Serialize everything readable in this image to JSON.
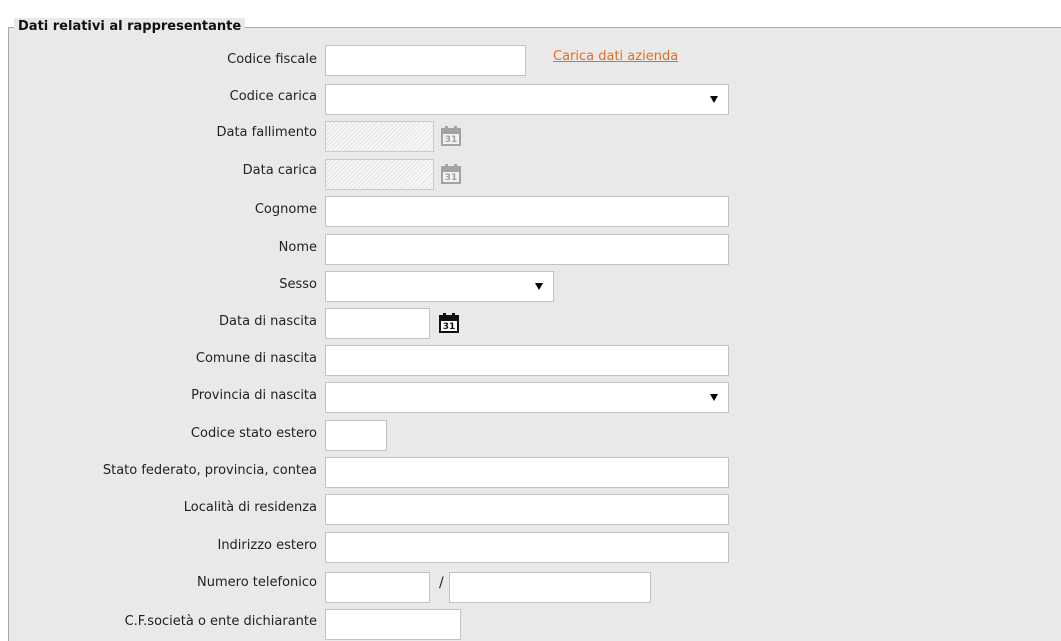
{
  "section": {
    "title": "Dati relativi al rappresentante"
  },
  "link": {
    "carica_dati_azienda": "Carica dati azienda"
  },
  "labels": {
    "codice_fiscale": "Codice fiscale",
    "codice_carica": "Codice carica",
    "data_fallimento": "Data fallimento",
    "data_carica": "Data carica",
    "cognome": "Cognome",
    "nome": "Nome",
    "sesso": "Sesso",
    "data_nascita": "Data di nascita",
    "comune_nascita": "Comune di nascita",
    "provincia_nascita": "Provincia di nascita",
    "codice_stato_estero": "Codice stato estero",
    "stato_federato": "Stato federato, provincia, contea",
    "localita_residenza": "Località di residenza",
    "indirizzo_estero": "Indirizzo estero",
    "numero_telefonico": "Numero telefonico",
    "cf_societa": "C.F.società o ente dichiarante"
  },
  "separators": {
    "phone": "/"
  },
  "calendar": {
    "day": "31"
  },
  "icons": {
    "calendar": "calendar-icon",
    "dropdown": "chevron-down-icon"
  },
  "colors": {
    "link": "#e36f1e",
    "panel": "#e9e9e9",
    "border": "#c2c2c2"
  }
}
